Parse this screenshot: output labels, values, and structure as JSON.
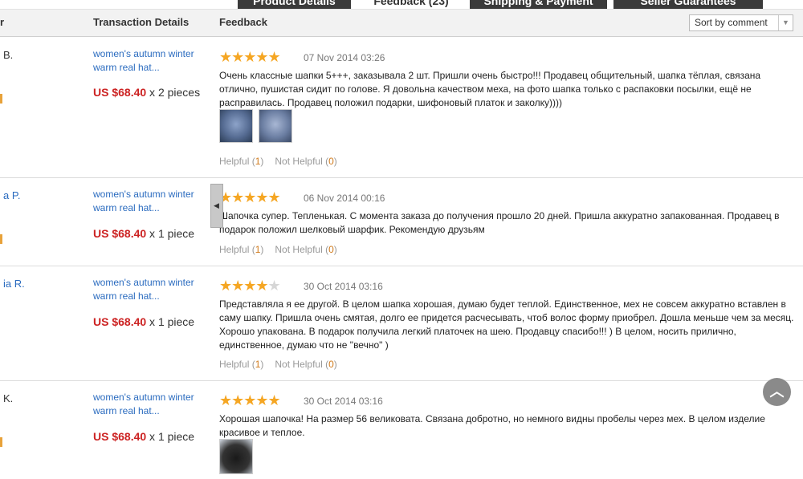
{
  "tabs": [
    {
      "label": "Product Details",
      "active": false
    },
    {
      "label": "Feedback (23)",
      "active": true
    },
    {
      "label": "Shipping & Payment",
      "active": false
    },
    {
      "label": "Seller Guarantees",
      "active": false
    }
  ],
  "header": {
    "buyer_col": "r",
    "transaction_col": "Transaction Details",
    "feedback_col": "Feedback",
    "sort_value": "Sort by comment"
  },
  "reviews": [
    {
      "buyer": "B.",
      "product": "women's autumn winter warm real hat...",
      "price": "US $68.40",
      "qty": " x 2 pieces",
      "stars": 5,
      "date": "07 Nov 2014 03:26",
      "text": "Очень классные шапки 5+++, заказывала 2 шт. Пришли очень быстро!!! Продавец общительный, шапка тёплая, связана отлично, пушистая сидит по голове. Я довольна качеством меха, на фото шапка только с распаковки посылки, ещё не расправилась. Продавец положил подарки, шифоновый платок и заколку))))",
      "helpful_label": "Helpful",
      "helpful_count": "1",
      "not_helpful_label": "Not Helpful",
      "not_helpful_count": "0"
    },
    {
      "buyer": "a P.",
      "product": "women's autumn winter warm real hat...",
      "price": "US $68.40",
      "qty": " x 1 piece",
      "stars": 5,
      "date": "06 Nov 2014 00:16",
      "text": "Шапочка супер. Тепленькая. С момента заказа до получения прошло 20 дней. Пришла аккуратно запакованная. Продавец в подарок положил шелковый шарфик. Рекомендую друзьям",
      "helpful_label": "Helpful",
      "helpful_count": "1",
      "not_helpful_label": "Not Helpful",
      "not_helpful_count": "0"
    },
    {
      "buyer": "ia R.",
      "product": "women's autumn winter warm real hat...",
      "price": "US $68.40",
      "qty": " x 1 piece",
      "stars": 4,
      "date": "30 Oct 2014 03:16",
      "text": "Представляла я ее другой. В целом шапка хорошая, думаю будет теплой. Единственное, мех не совсем аккуратно вставлен в саму шапку. Пришла очень смятая, долго ее придется расчесывать, чтоб волос форму приобрел. Дошла меньше чем за месяц. Хорошо упакована. В подарок получила легкий платочек на шею. Продавцу спасибо!!! ) В целом, носить прилично, единственное, думаю что не \"вечно\" )",
      "helpful_label": "Helpful",
      "helpful_count": "1",
      "not_helpful_label": "Not Helpful",
      "not_helpful_count": "0"
    },
    {
      "buyer": "K.",
      "product": "women's autumn winter warm real hat...",
      "price": "US $68.40",
      "qty": " x 1 piece",
      "stars": 5,
      "date": "30 Oct 2014 03:16",
      "text": "Хорошая шапочка! На размер 56 великовата. Связана добротно, но немного видны пробелы через мех. В целом изделие красивое и теплое."
    }
  ],
  "colors": {
    "accent_price": "#cc2222",
    "link": "#2a6bbf",
    "star": "#f5a623",
    "tab_dark": "#3a3a3a"
  },
  "icons": {
    "sort_arrow": "chevron-down-icon",
    "side_tab": "chevron-left-icon",
    "back_to_top": "chevron-up-icon"
  }
}
